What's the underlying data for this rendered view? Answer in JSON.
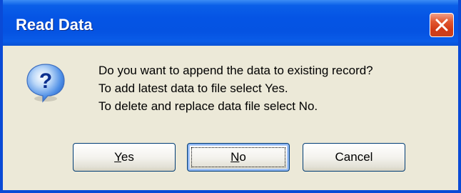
{
  "window": {
    "title": "Read Data"
  },
  "titlebar": {
    "close_icon": "close-icon"
  },
  "dialog": {
    "icon": "question-icon",
    "message_lines": [
      "Do you want to append the data to existing record?",
      "To add latest data to file select Yes.",
      "To delete and replace data file select No."
    ]
  },
  "buttons": {
    "yes": {
      "mnemonic": "Y",
      "rest": "es"
    },
    "no": {
      "mnemonic": "N",
      "rest": "o"
    },
    "cancel": {
      "label": "Cancel"
    }
  },
  "colors": {
    "titlebar": "#0554e4",
    "close": "#d23a15",
    "face": "#ece9d8",
    "button_border": "#003c74"
  }
}
